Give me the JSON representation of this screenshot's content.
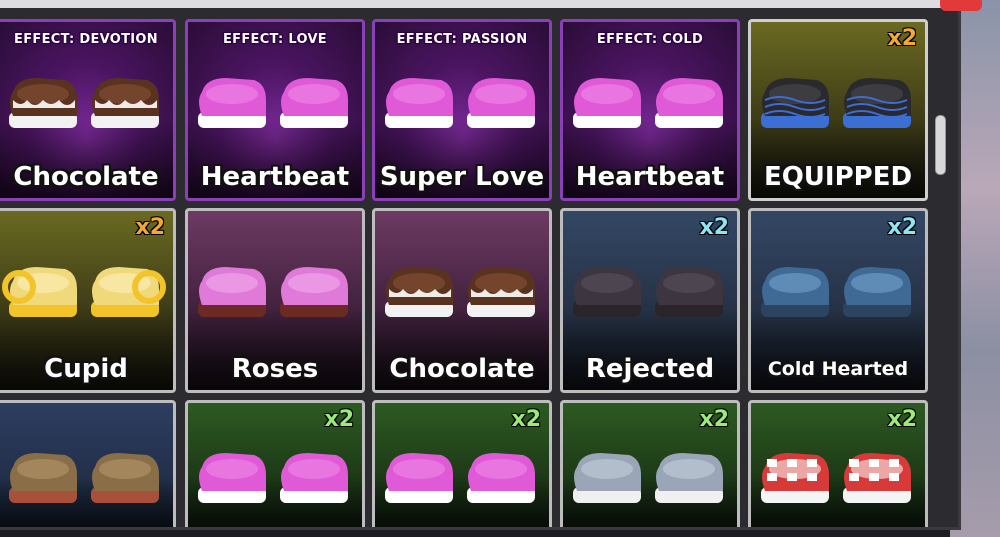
{
  "inventory": {
    "items": [
      {
        "name": "Chocolate",
        "effect": "EFFECT: DEVOTION",
        "qty": "",
        "style": "choco",
        "bg": "fx"
      },
      {
        "name": "Heartbeat",
        "effect": "EFFECT: LOVE",
        "qty": "",
        "style": "pink",
        "bg": "fx"
      },
      {
        "name": "Super Love",
        "effect": "EFFECT: PASSION",
        "qty": "",
        "style": "pink",
        "bg": "fx"
      },
      {
        "name": "Heartbeat",
        "effect": "EFFECT: COLD",
        "qty": "",
        "style": "pink",
        "bg": "fx"
      },
      {
        "name": "EQUIPPED",
        "effect": "",
        "qty": "x2",
        "style": "black",
        "bg": "olive"
      },
      {
        "name": "Cupid",
        "effect": "",
        "qty": "x2",
        "style": "gold",
        "bg": "olive"
      },
      {
        "name": "Roses",
        "effect": "",
        "qty": "",
        "style": "rose",
        "bg": "pink"
      },
      {
        "name": "Chocolate",
        "effect": "",
        "qty": "",
        "style": "choco",
        "bg": "pink"
      },
      {
        "name": "Rejected",
        "effect": "",
        "qty": "x2",
        "style": "dark",
        "bg": "blue"
      },
      {
        "name": "Cold Hearted",
        "effect": "",
        "qty": "x2",
        "style": "ice",
        "bg": "blue"
      },
      {
        "name": "",
        "effect": "",
        "qty": "",
        "style": "brown",
        "bg": "navy"
      },
      {
        "name": "",
        "effect": "",
        "qty": "x2",
        "style": "pink",
        "bg": "green"
      },
      {
        "name": "",
        "effect": "",
        "qty": "x2",
        "style": "pink",
        "bg": "green"
      },
      {
        "name": "",
        "effect": "",
        "qty": "x2",
        "style": "silver",
        "bg": "green"
      },
      {
        "name": "",
        "effect": "",
        "qty": "x2",
        "style": "redwhite",
        "bg": "green"
      }
    ]
  },
  "palette": {
    "choco": {
      "top": "#5a3220",
      "top2": "#8a5436",
      "fur": "#f2f2f2"
    },
    "pink": {
      "top": "#e05ad8",
      "top2": "#f08ee8",
      "fur": "#ffffff"
    },
    "black": {
      "top": "#2a2a2e",
      "top2": "#4a4a52",
      "fur": "#3b6fd6"
    },
    "gold": {
      "top": "#f0d97a",
      "top2": "#fff3c2",
      "fur": "#f2c42a"
    },
    "rose": {
      "top": "#e07ad8",
      "top2": "#f4b0ee",
      "fur": "#6b2a24"
    },
    "dark": {
      "top": "#3d3640",
      "top2": "#5b535f",
      "fur": "#2a242b"
    },
    "ice": {
      "top": "#3f6a96",
      "top2": "#7aa8d2",
      "fur": "#2c4460"
    },
    "brown": {
      "top": "#8a6e48",
      "top2": "#b89a6e",
      "fur": "#a8503a"
    },
    "silver": {
      "top": "#9aa6b8",
      "top2": "#c9d2de",
      "fur": "#f0f0f0"
    },
    "redwhite": {
      "top": "#d83a3a",
      "top2": "#ffffff",
      "fur": "#f4f4f4"
    }
  }
}
